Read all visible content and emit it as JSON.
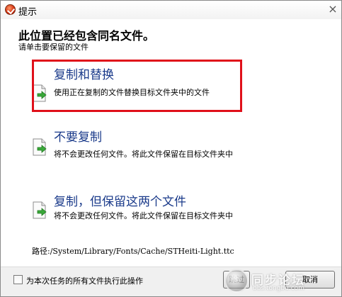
{
  "window": {
    "title": "提示",
    "close_icon": "×"
  },
  "main": {
    "heading": "此位置已经包含同名文件。",
    "subheading": "请单击要保留的文件",
    "options": [
      {
        "title": "复制和替换",
        "description": "使用正在复制的文件替换目标文件夹中的文件",
        "icon": "document-arrow-icon",
        "highlighted": true
      },
      {
        "title": "不要复制",
        "description": "将不会更改任何文件。将此文件保留在目标文件夹中",
        "icon": "document-arrow-icon"
      },
      {
        "title": "复制，但保留这两个文件",
        "description": "将不会更改任何文件。将此文件保留在目标文件夹中",
        "icon": "document-arrow-icon"
      }
    ],
    "path": "路径:/System/Library/Fonts/Cache/STHeiti-Light.ttc"
  },
  "footer": {
    "checkbox_label": "为本次任务的所有文件执行此操作",
    "checkbox_checked": false,
    "skip_label": "跳过",
    "cancel_label": "取消"
  },
  "watermark": {
    "text": "同步论坛",
    "sub": "bbs.tongbu.com"
  },
  "colors": {
    "highlight": "#e0101a",
    "option_title": "#1a3a8a"
  }
}
